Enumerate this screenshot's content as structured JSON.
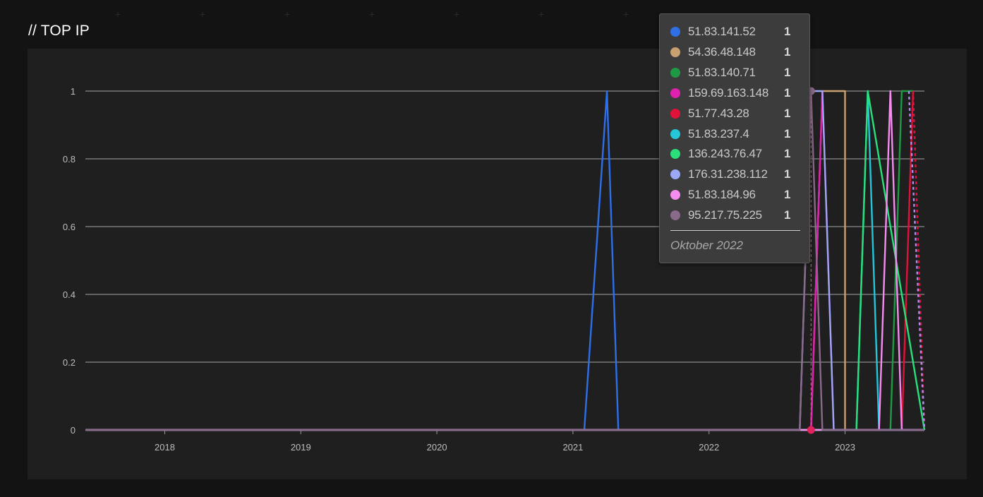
{
  "section_title": "// TOP IP",
  "colors": {
    "page_bg": "#131313",
    "panel_bg": "#1f1f1f",
    "grid": "#8a8a8a",
    "tooltip_bg": "#3c3c3c"
  },
  "chart_data": {
    "type": "line",
    "title": "",
    "xlabel": "",
    "ylabel": "",
    "ylim": [
      0,
      1
    ],
    "yticks": [
      "0",
      "0.2",
      "0.4",
      "0.6",
      "0.8",
      "1"
    ],
    "xticks": [
      "2018",
      "2019",
      "2020",
      "2021",
      "2022",
      "2023"
    ],
    "xlim": [
      "2017-06",
      "2023-08"
    ],
    "grid": true,
    "series": [
      {
        "name": "51.83.141.52",
        "color": "#2f6fe8",
        "x": [
          "2017-06",
          "2021-02",
          "2021-04",
          "2021-05",
          "2023-08"
        ],
        "y": [
          0,
          0,
          1,
          0,
          0
        ]
      },
      {
        "name": "54.36.48.148",
        "color": "#c9a070",
        "x": [
          "2017-06",
          "2022-10",
          "2022-11",
          "2022-12",
          "2023-01",
          "2023-01",
          "2023-08"
        ],
        "y": [
          0,
          0,
          1,
          1,
          1,
          0,
          0
        ]
      },
      {
        "name": "51.83.140.71",
        "color": "#1e9a45",
        "x": [
          "2017-06",
          "2023-05",
          "2023-06",
          "2023-07"
        ],
        "y": [
          0,
          0,
          1,
          1
        ]
      },
      {
        "name": "159.69.163.148",
        "color": "#e020b0",
        "x": [
          "2017-06",
          "2022-10",
          "2022-11",
          "2022-12",
          "2023-08"
        ],
        "y": [
          0,
          0,
          1,
          0,
          0
        ]
      },
      {
        "name": "51.77.43.28",
        "color": "#e0123a",
        "x": [
          "2017-06",
          "2023-06",
          "2023-07"
        ],
        "y": [
          0,
          0,
          1
        ]
      },
      {
        "name": "51.83.237.4",
        "color": "#26c6da",
        "x": [
          "2017-06",
          "2023-02",
          "2023-03",
          "2023-04",
          "2023-08"
        ],
        "y": [
          0,
          0,
          1,
          0,
          0
        ]
      },
      {
        "name": "136.243.76.47",
        "color": "#29e07a",
        "x": [
          "2017-06",
          "2023-02",
          "2023-03",
          "2023-08"
        ],
        "y": [
          0,
          0,
          1,
          0
        ]
      },
      {
        "name": "176.31.238.112",
        "color": "#9aa8f5",
        "x": [
          "2017-06",
          "2022-09",
          "2022-10",
          "2022-11",
          "2022-12",
          "2023-08"
        ],
        "y": [
          0,
          0,
          1,
          1,
          0,
          0
        ]
      },
      {
        "name": "51.83.184.96",
        "color": "#f58cf0",
        "x": [
          "2017-06",
          "2023-04",
          "2023-05",
          "2023-06",
          "2023-08"
        ],
        "y": [
          0,
          0,
          1,
          0,
          0
        ]
      },
      {
        "name": "95.217.75.225",
        "color": "#8a6a8a",
        "x": [
          "2017-06",
          "2022-09",
          "2022-10",
          "2022-11",
          "2023-08"
        ],
        "y": [
          0,
          0,
          1,
          0,
          0
        ]
      }
    ],
    "hover": {
      "x": "2022-10",
      "label": "Oktober 2022",
      "values": [
        {
          "name": "51.83.141.52",
          "value": "1",
          "color": "#2f6fe8"
        },
        {
          "name": "54.36.48.148",
          "value": "1",
          "color": "#c9a070"
        },
        {
          "name": "51.83.140.71",
          "value": "1",
          "color": "#1e9a45"
        },
        {
          "name": "159.69.163.148",
          "value": "1",
          "color": "#e020b0"
        },
        {
          "name": "51.77.43.28",
          "value": "1",
          "color": "#e0123a"
        },
        {
          "name": "51.83.237.4",
          "value": "1",
          "color": "#26c6da"
        },
        {
          "name": "136.243.76.47",
          "value": "1",
          "color": "#29e07a"
        },
        {
          "name": "176.31.238.112",
          "value": "1",
          "color": "#9aa8f5"
        },
        {
          "name": "51.83.184.96",
          "value": "1",
          "color": "#f58cf0"
        },
        {
          "name": "95.217.75.225",
          "value": "1",
          "color": "#8a6a8a"
        }
      ]
    }
  }
}
